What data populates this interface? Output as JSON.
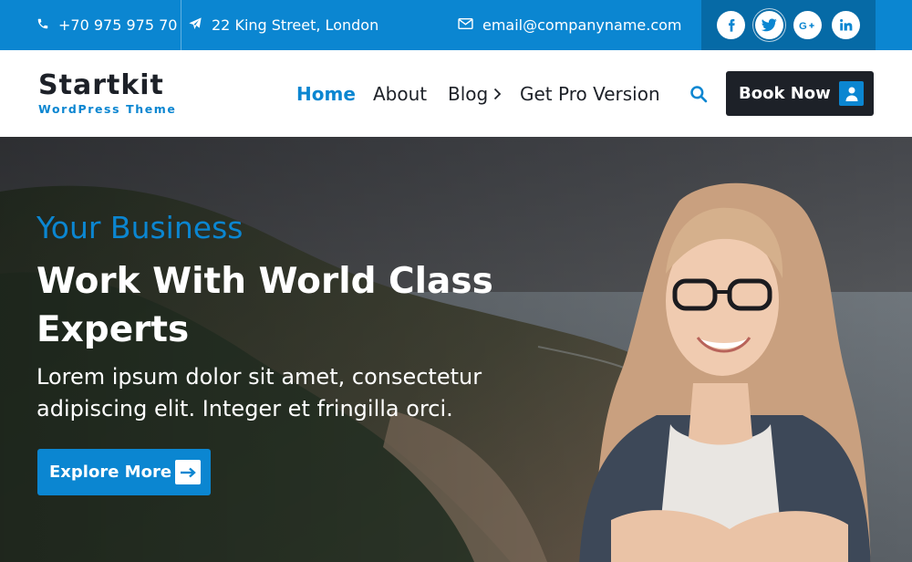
{
  "topbar": {
    "phone": "+70 975 975 70",
    "address": "22 King Street, London",
    "email": "email@companyname.com",
    "social": [
      {
        "name": "facebook",
        "glyph": "f"
      },
      {
        "name": "twitter",
        "glyph": "t"
      },
      {
        "name": "google-plus",
        "glyph": "G+"
      },
      {
        "name": "linkedin",
        "glyph": "in"
      }
    ]
  },
  "header": {
    "logo_title": "Startkit",
    "logo_subtitle": "WordPress Theme",
    "nav": {
      "home": "Home",
      "about": "About",
      "blog": "Blog",
      "pro": "Get Pro Version"
    },
    "book_label": "Book Now"
  },
  "hero": {
    "kicker": "Your Business",
    "title": "Work With World Class Experts",
    "text": "Lorem ipsum dolor sit amet, consectetur adipiscing elit. Integer et fringilla orci.",
    "button_label": "Explore More"
  },
  "colors": {
    "accent": "#0b86d1",
    "accent_dark": "#066aa6",
    "dark": "#1d2128"
  },
  "icons": [
    "phone-icon",
    "paper-plane-icon",
    "envelope-icon",
    "search-icon",
    "user-icon",
    "arrow-right-icon",
    "chevron-right-icon"
  ]
}
